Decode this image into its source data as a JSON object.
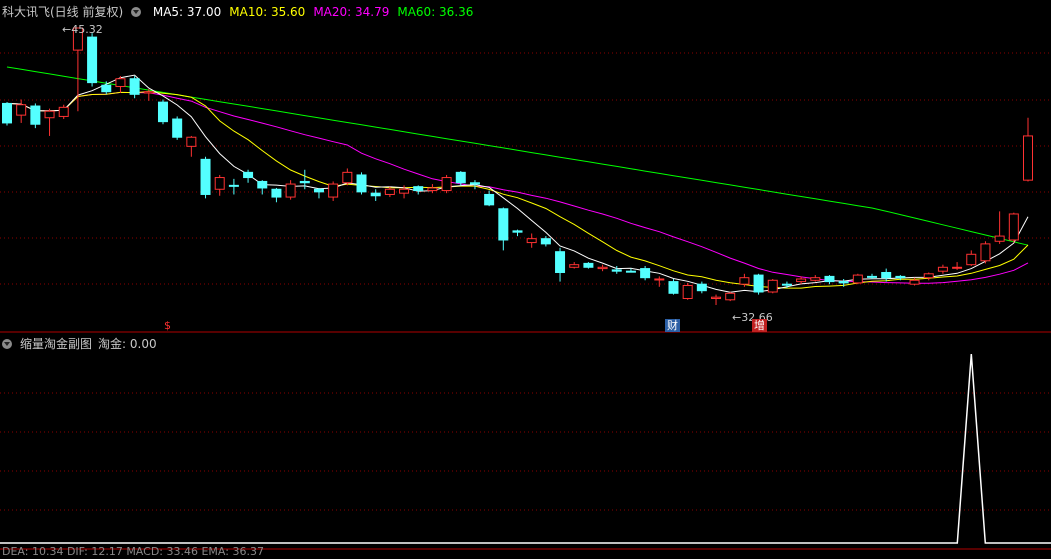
{
  "main_panel": {
    "title": "科大讯飞(日线 前复权)",
    "ma_items": [
      {
        "label": "MA5: 37.00",
        "color": "#ffffff"
      },
      {
        "label": "MA10: 35.60",
        "color": "#ffff00"
      },
      {
        "label": "MA20: 34.79",
        "color": "#ff00ff"
      },
      {
        "label": "MA60: 36.36",
        "color": "#00ff00"
      }
    ],
    "high_label": "45.32",
    "low_label": "32.66",
    "event_tags": [
      {
        "text": "$",
        "color": "#ff3030",
        "bg": "transparent"
      },
      {
        "text": "财",
        "color": "#ffffff",
        "bg": "#2b5fa5"
      },
      {
        "text": "增",
        "color": "#ffffff",
        "bg": "#c02020"
      }
    ],
    "price_range": [
      31.0,
      47.0
    ],
    "candles": [
      [
        38.0,
        39.5,
        37.8,
        39.6,
        "d"
      ],
      [
        38.6,
        39.4,
        38.0,
        39.8,
        "u"
      ],
      [
        39.3,
        37.9,
        37.6,
        39.5,
        "d"
      ],
      [
        38.4,
        38.9,
        37.0,
        39.1,
        "u"
      ],
      [
        38.5,
        39.2,
        38.3,
        39.4,
        "u"
      ],
      [
        43.6,
        45.3,
        38.9,
        45.3,
        "u"
      ],
      [
        44.6,
        41.1,
        40.8,
        44.9,
        "d"
      ],
      [
        40.9,
        40.4,
        40.2,
        41.2,
        "d"
      ],
      [
        40.8,
        41.4,
        40.3,
        41.6,
        "u"
      ],
      [
        41.4,
        40.2,
        39.9,
        41.6,
        "d"
      ],
      [
        40.4,
        40.3,
        39.7,
        40.6,
        "u"
      ],
      [
        39.6,
        38.1,
        37.9,
        39.8,
        "d"
      ],
      [
        38.3,
        36.9,
        36.7,
        38.5,
        "d"
      ],
      [
        36.2,
        36.9,
        35.4,
        37.0,
        "u"
      ],
      [
        35.2,
        32.5,
        32.2,
        35.4,
        "d"
      ],
      [
        32.9,
        33.8,
        32.4,
        34.0,
        "u"
      ],
      [
        33.2,
        33.2,
        32.5,
        33.7,
        "d"
      ],
      [
        34.2,
        33.8,
        33.4,
        34.4,
        "d"
      ],
      [
        33.5,
        33.0,
        32.5,
        33.6,
        "d"
      ],
      [
        32.9,
        32.3,
        31.9,
        33.0,
        "d"
      ],
      [
        32.3,
        33.3,
        32.1,
        33.6,
        "u"
      ],
      [
        33.5,
        33.4,
        32.9,
        34.4,
        "d"
      ],
      [
        32.9,
        32.7,
        32.2,
        33.0,
        "d"
      ],
      [
        32.3,
        33.3,
        32.0,
        33.5,
        "u"
      ],
      [
        33.4,
        34.2,
        33.2,
        34.5,
        "u"
      ],
      [
        34.0,
        32.7,
        32.5,
        34.2,
        "d"
      ],
      [
        32.6,
        32.4,
        32.0,
        32.9,
        "d"
      ],
      [
        32.5,
        32.9,
        32.3,
        33.1,
        "u"
      ],
      [
        32.6,
        32.9,
        32.2,
        33.2,
        "u"
      ],
      [
        33.1,
        32.8,
        32.5,
        33.2,
        "d"
      ],
      [
        32.8,
        33.0,
        32.6,
        33.3,
        "u"
      ],
      [
        32.8,
        33.8,
        32.6,
        34.0,
        "u"
      ],
      [
        34.2,
        33.4,
        33.2,
        34.3,
        "d"
      ],
      [
        33.4,
        33.3,
        32.9,
        33.6,
        "d"
      ],
      [
        32.5,
        31.7,
        31.6,
        32.8,
        "d"
      ],
      [
        31.4,
        29.0,
        28.2,
        31.5,
        "d"
      ],
      [
        29.6,
        29.7,
        29.3,
        29.8,
        "d"
      ],
      [
        29.1,
        28.8,
        28.4,
        29.5,
        "u"
      ],
      [
        29.1,
        28.7,
        28.5,
        29.3,
        "d"
      ],
      [
        28.1,
        26.5,
        25.8,
        28.4,
        "d"
      ],
      [
        26.9,
        27.1,
        26.8,
        27.3,
        "u"
      ],
      [
        27.2,
        26.9,
        26.8,
        27.3,
        "d"
      ],
      [
        26.8,
        26.9,
        26.6,
        27.1,
        "u"
      ],
      [
        26.7,
        26.6,
        26.4,
        27.0,
        "d"
      ],
      [
        26.6,
        26.6,
        26.5,
        26.8,
        "d"
      ],
      [
        26.8,
        26.1,
        25.9,
        27.0,
        "d"
      ],
      [
        26.0,
        26.0,
        25.4,
        26.2,
        "u"
      ],
      [
        25.8,
        24.9,
        24.8,
        26.0,
        "d"
      ],
      [
        24.5,
        25.5,
        24.4,
        25.7,
        "u"
      ],
      [
        25.6,
        25.1,
        24.9,
        25.8,
        "d"
      ],
      [
        24.6,
        24.5,
        24.0,
        24.8,
        "u"
      ],
      [
        24.4,
        24.9,
        24.3,
        25.0,
        "u"
      ],
      [
        26.1,
        25.6,
        25.4,
        26.4,
        "u"
      ],
      [
        26.3,
        25.0,
        24.8,
        26.4,
        "d"
      ],
      [
        25.0,
        25.9,
        24.9,
        26.0,
        "u"
      ],
      [
        25.6,
        25.6,
        25.3,
        25.8,
        "d"
      ],
      [
        25.8,
        26.0,
        25.6,
        26.2,
        "u"
      ],
      [
        25.9,
        26.1,
        25.8,
        26.3,
        "u"
      ],
      [
        26.2,
        25.8,
        25.6,
        26.3,
        "d"
      ],
      [
        25.8,
        25.7,
        25.4,
        26.0,
        "d"
      ],
      [
        25.7,
        26.3,
        25.6,
        26.4,
        "u"
      ],
      [
        26.2,
        26.2,
        26.0,
        26.4,
        "d"
      ],
      [
        26.5,
        26.1,
        25.8,
        26.8,
        "d"
      ],
      [
        26.2,
        26.1,
        25.9,
        26.3,
        "d"
      ],
      [
        25.6,
        25.9,
        25.5,
        26.1,
        "u"
      ],
      [
        26.1,
        26.4,
        25.9,
        26.5,
        "u"
      ],
      [
        26.6,
        26.9,
        26.4,
        27.1,
        "u"
      ],
      [
        26.9,
        26.9,
        26.7,
        27.3,
        "u"
      ],
      [
        27.1,
        27.9,
        27.0,
        28.2,
        "u"
      ],
      [
        27.4,
        28.7,
        27.2,
        28.9,
        "u"
      ],
      [
        28.9,
        29.3,
        28.7,
        31.2,
        "u"
      ],
      [
        29.0,
        31.0,
        28.8,
        31.1,
        "u"
      ],
      [
        33.6,
        37.0,
        33.5,
        38.4,
        "u"
      ]
    ]
  },
  "sub_panel": {
    "title": "缩量淘金副图",
    "value_label": "淘金: 0.00",
    "spike_index": 68,
    "spike_value": 1.0
  },
  "bottom_strip": {
    "text": "DEA: 10.34  DIF: 12.17  MACD: 33.46  EMA: 36.37"
  },
  "colors": {
    "up": "#ff3232",
    "down": "#54ffff",
    "grid": "#8b0000",
    "frame": "#b00000",
    "ma5": "#ffffff",
    "ma10": "#ffff00",
    "ma20": "#ff00ff",
    "ma60": "#00ff00"
  }
}
